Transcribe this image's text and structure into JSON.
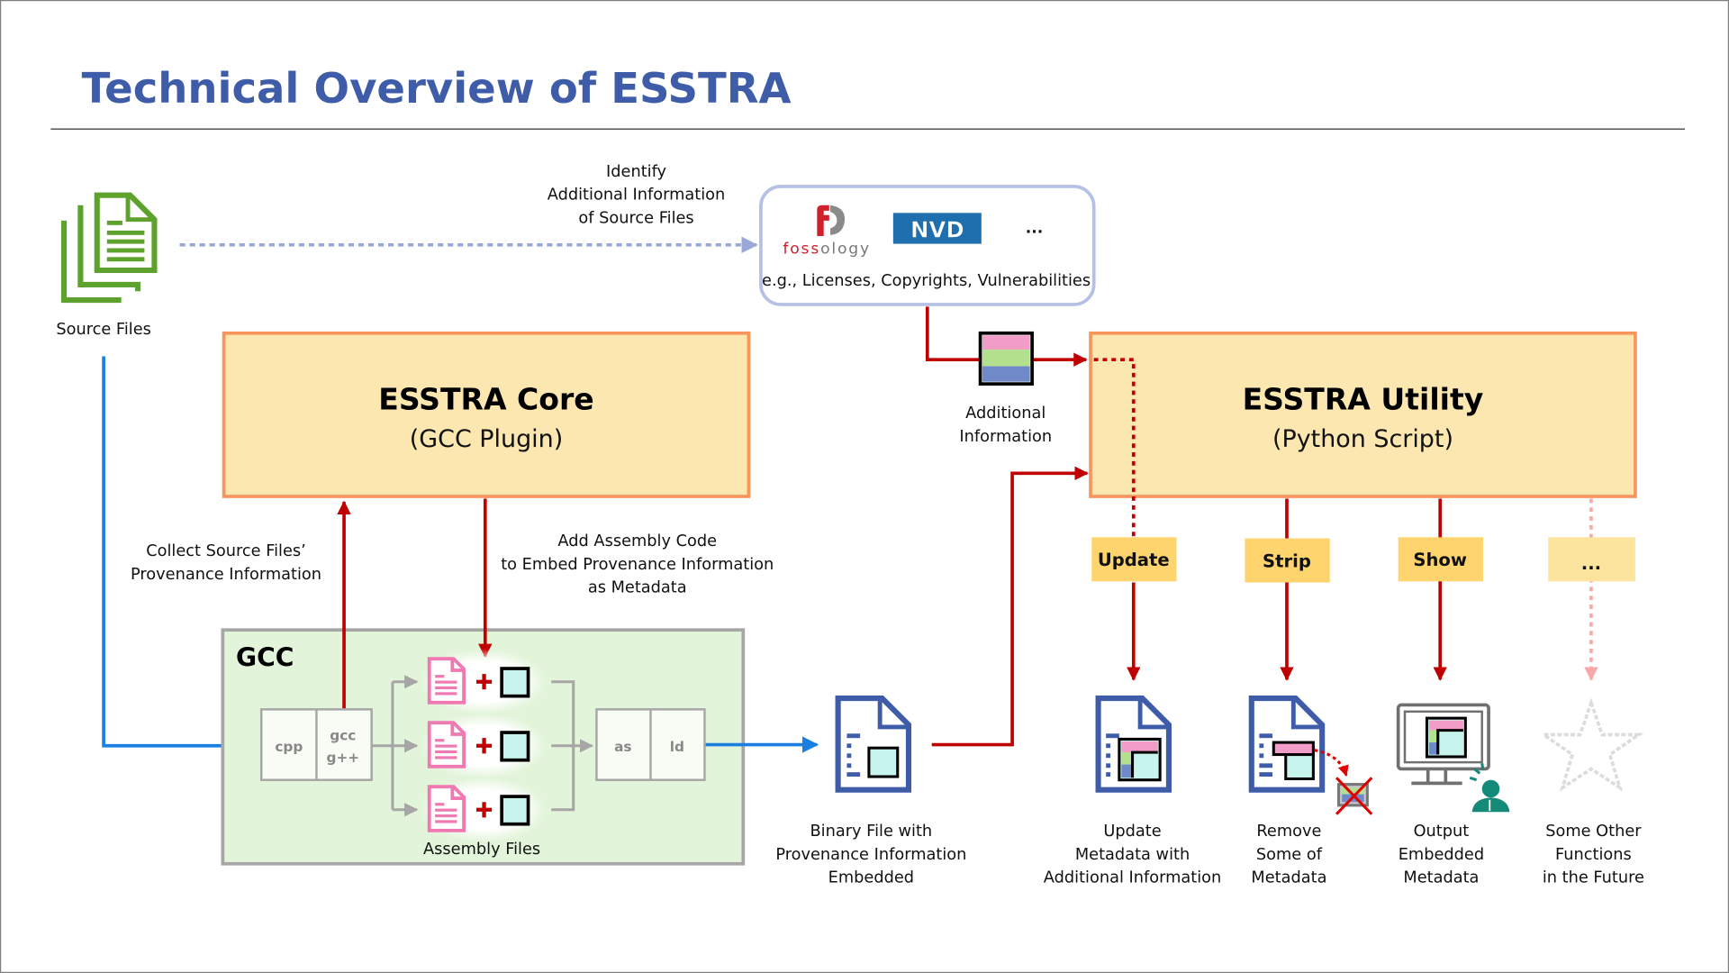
{
  "title": "Technical Overview of ESSTRA",
  "colors": {
    "title": "#3f5ca8",
    "source_green": "#5ea22e",
    "red_arrow": "#c00000",
    "blue_arrow": "#1a7fe0",
    "dotted_lavender": "#9aa8d8",
    "box_fill": "#fde7b0",
    "box_border": "#f7955d",
    "cmd_fill": "#fdd46e",
    "cmd_faded": "#fde49e",
    "gcc_fill": "#e2f4d9",
    "gcc_border": "#a6a6a6",
    "doc_blue": "#3f5ca8",
    "pink": "#f29dc8",
    "green": "#b3e08c",
    "blue": "#7089c8",
    "cyan": "#c8f4ee",
    "teal_person": "#148a78"
  },
  "source_files": {
    "label": "Source Files",
    "icon": "stacked-documents-icon"
  },
  "identify_label": [
    "Identify",
    "Additional Information",
    "of Source Files"
  ],
  "external_tools": {
    "logos": [
      "fossology",
      "NVD",
      "..."
    ],
    "fossology_parts": [
      "foss",
      "ology"
    ],
    "caption": "e.g., Licenses, Copyrights, Vulnerabilities"
  },
  "additional_info": {
    "label": [
      "Additional",
      "Information"
    ]
  },
  "esstra_core": {
    "title": "ESSTRA Core",
    "subtitle": "(GCC Plugin)"
  },
  "esstra_utility": {
    "title": "ESSTRA Utility",
    "subtitle": "(Python Script)"
  },
  "collect_label": [
    "Collect Source Files’",
    "Provenance Information"
  ],
  "add_asm_label": [
    "Add Assembly Code",
    "to Embed Provenance Information",
    "as Metadata"
  ],
  "gcc": {
    "title": "GCC",
    "stages": [
      "cpp",
      "gcc",
      "g++",
      "as",
      "ld"
    ],
    "assembly_label": "Assembly Files"
  },
  "binary": {
    "label": [
      "Binary File with",
      "Provenance Information",
      "Embedded"
    ]
  },
  "commands": [
    {
      "name": "Update",
      "label": [
        "Update",
        "Metadata with",
        "Additional Information"
      ]
    },
    {
      "name": "Strip",
      "label": [
        "Remove",
        "Some of",
        "Metadata"
      ]
    },
    {
      "name": "Show",
      "label": [
        "Output",
        "Embedded",
        "Metadata"
      ]
    },
    {
      "name": "...",
      "label": [
        "Some Other",
        "Functions",
        "in the Future"
      ]
    }
  ]
}
